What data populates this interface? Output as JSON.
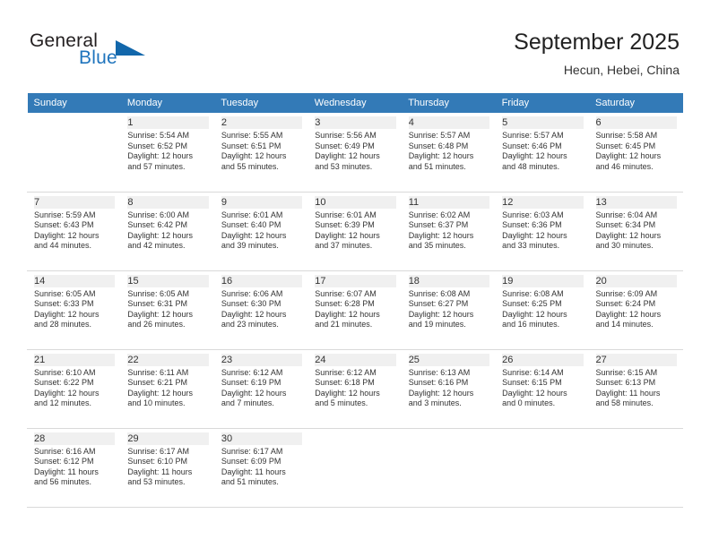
{
  "brand": {
    "name_part1": "General",
    "name_part2": "Blue",
    "triangle_color": "#1267ab",
    "blue_color": "#1f74bd"
  },
  "header": {
    "title": "September 2025",
    "location": "Hecun, Hebei, China",
    "header_bg": "#337ab7"
  },
  "calendar": {
    "weekday_headers": [
      "Sunday",
      "Monday",
      "Tuesday",
      "Wednesday",
      "Thursday",
      "Friday",
      "Saturday"
    ],
    "weeks": [
      [
        {
          "day": "",
          "sunrise": "",
          "sunset": "",
          "daylight1": "",
          "daylight2": ""
        },
        {
          "day": "1",
          "sunrise": "Sunrise: 5:54 AM",
          "sunset": "Sunset: 6:52 PM",
          "daylight1": "Daylight: 12 hours",
          "daylight2": "and 57 minutes."
        },
        {
          "day": "2",
          "sunrise": "Sunrise: 5:55 AM",
          "sunset": "Sunset: 6:51 PM",
          "daylight1": "Daylight: 12 hours",
          "daylight2": "and 55 minutes."
        },
        {
          "day": "3",
          "sunrise": "Sunrise: 5:56 AM",
          "sunset": "Sunset: 6:49 PM",
          "daylight1": "Daylight: 12 hours",
          "daylight2": "and 53 minutes."
        },
        {
          "day": "4",
          "sunrise": "Sunrise: 5:57 AM",
          "sunset": "Sunset: 6:48 PM",
          "daylight1": "Daylight: 12 hours",
          "daylight2": "and 51 minutes."
        },
        {
          "day": "5",
          "sunrise": "Sunrise: 5:57 AM",
          "sunset": "Sunset: 6:46 PM",
          "daylight1": "Daylight: 12 hours",
          "daylight2": "and 48 minutes."
        },
        {
          "day": "6",
          "sunrise": "Sunrise: 5:58 AM",
          "sunset": "Sunset: 6:45 PM",
          "daylight1": "Daylight: 12 hours",
          "daylight2": "and 46 minutes."
        }
      ],
      [
        {
          "day": "7",
          "sunrise": "Sunrise: 5:59 AM",
          "sunset": "Sunset: 6:43 PM",
          "daylight1": "Daylight: 12 hours",
          "daylight2": "and 44 minutes."
        },
        {
          "day": "8",
          "sunrise": "Sunrise: 6:00 AM",
          "sunset": "Sunset: 6:42 PM",
          "daylight1": "Daylight: 12 hours",
          "daylight2": "and 42 minutes."
        },
        {
          "day": "9",
          "sunrise": "Sunrise: 6:01 AM",
          "sunset": "Sunset: 6:40 PM",
          "daylight1": "Daylight: 12 hours",
          "daylight2": "and 39 minutes."
        },
        {
          "day": "10",
          "sunrise": "Sunrise: 6:01 AM",
          "sunset": "Sunset: 6:39 PM",
          "daylight1": "Daylight: 12 hours",
          "daylight2": "and 37 minutes."
        },
        {
          "day": "11",
          "sunrise": "Sunrise: 6:02 AM",
          "sunset": "Sunset: 6:37 PM",
          "daylight1": "Daylight: 12 hours",
          "daylight2": "and 35 minutes."
        },
        {
          "day": "12",
          "sunrise": "Sunrise: 6:03 AM",
          "sunset": "Sunset: 6:36 PM",
          "daylight1": "Daylight: 12 hours",
          "daylight2": "and 33 minutes."
        },
        {
          "day": "13",
          "sunrise": "Sunrise: 6:04 AM",
          "sunset": "Sunset: 6:34 PM",
          "daylight1": "Daylight: 12 hours",
          "daylight2": "and 30 minutes."
        }
      ],
      [
        {
          "day": "14",
          "sunrise": "Sunrise: 6:05 AM",
          "sunset": "Sunset: 6:33 PM",
          "daylight1": "Daylight: 12 hours",
          "daylight2": "and 28 minutes."
        },
        {
          "day": "15",
          "sunrise": "Sunrise: 6:05 AM",
          "sunset": "Sunset: 6:31 PM",
          "daylight1": "Daylight: 12 hours",
          "daylight2": "and 26 minutes."
        },
        {
          "day": "16",
          "sunrise": "Sunrise: 6:06 AM",
          "sunset": "Sunset: 6:30 PM",
          "daylight1": "Daylight: 12 hours",
          "daylight2": "and 23 minutes."
        },
        {
          "day": "17",
          "sunrise": "Sunrise: 6:07 AM",
          "sunset": "Sunset: 6:28 PM",
          "daylight1": "Daylight: 12 hours",
          "daylight2": "and 21 minutes."
        },
        {
          "day": "18",
          "sunrise": "Sunrise: 6:08 AM",
          "sunset": "Sunset: 6:27 PM",
          "daylight1": "Daylight: 12 hours",
          "daylight2": "and 19 minutes."
        },
        {
          "day": "19",
          "sunrise": "Sunrise: 6:08 AM",
          "sunset": "Sunset: 6:25 PM",
          "daylight1": "Daylight: 12 hours",
          "daylight2": "and 16 minutes."
        },
        {
          "day": "20",
          "sunrise": "Sunrise: 6:09 AM",
          "sunset": "Sunset: 6:24 PM",
          "daylight1": "Daylight: 12 hours",
          "daylight2": "and 14 minutes."
        }
      ],
      [
        {
          "day": "21",
          "sunrise": "Sunrise: 6:10 AM",
          "sunset": "Sunset: 6:22 PM",
          "daylight1": "Daylight: 12 hours",
          "daylight2": "and 12 minutes."
        },
        {
          "day": "22",
          "sunrise": "Sunrise: 6:11 AM",
          "sunset": "Sunset: 6:21 PM",
          "daylight1": "Daylight: 12 hours",
          "daylight2": "and 10 minutes."
        },
        {
          "day": "23",
          "sunrise": "Sunrise: 6:12 AM",
          "sunset": "Sunset: 6:19 PM",
          "daylight1": "Daylight: 12 hours",
          "daylight2": "and 7 minutes."
        },
        {
          "day": "24",
          "sunrise": "Sunrise: 6:12 AM",
          "sunset": "Sunset: 6:18 PM",
          "daylight1": "Daylight: 12 hours",
          "daylight2": "and 5 minutes."
        },
        {
          "day": "25",
          "sunrise": "Sunrise: 6:13 AM",
          "sunset": "Sunset: 6:16 PM",
          "daylight1": "Daylight: 12 hours",
          "daylight2": "and 3 minutes."
        },
        {
          "day": "26",
          "sunrise": "Sunrise: 6:14 AM",
          "sunset": "Sunset: 6:15 PM",
          "daylight1": "Daylight: 12 hours",
          "daylight2": "and 0 minutes."
        },
        {
          "day": "27",
          "sunrise": "Sunrise: 6:15 AM",
          "sunset": "Sunset: 6:13 PM",
          "daylight1": "Daylight: 11 hours",
          "daylight2": "and 58 minutes."
        }
      ],
      [
        {
          "day": "28",
          "sunrise": "Sunrise: 6:16 AM",
          "sunset": "Sunset: 6:12 PM",
          "daylight1": "Daylight: 11 hours",
          "daylight2": "and 56 minutes."
        },
        {
          "day": "29",
          "sunrise": "Sunrise: 6:17 AM",
          "sunset": "Sunset: 6:10 PM",
          "daylight1": "Daylight: 11 hours",
          "daylight2": "and 53 minutes."
        },
        {
          "day": "30",
          "sunrise": "Sunrise: 6:17 AM",
          "sunset": "Sunset: 6:09 PM",
          "daylight1": "Daylight: 11 hours",
          "daylight2": "and 51 minutes."
        },
        {
          "day": "",
          "sunrise": "",
          "sunset": "",
          "daylight1": "",
          "daylight2": ""
        },
        {
          "day": "",
          "sunrise": "",
          "sunset": "",
          "daylight1": "",
          "daylight2": ""
        },
        {
          "day": "",
          "sunrise": "",
          "sunset": "",
          "daylight1": "",
          "daylight2": ""
        },
        {
          "day": "",
          "sunrise": "",
          "sunset": "",
          "daylight1": "",
          "daylight2": ""
        }
      ]
    ]
  }
}
